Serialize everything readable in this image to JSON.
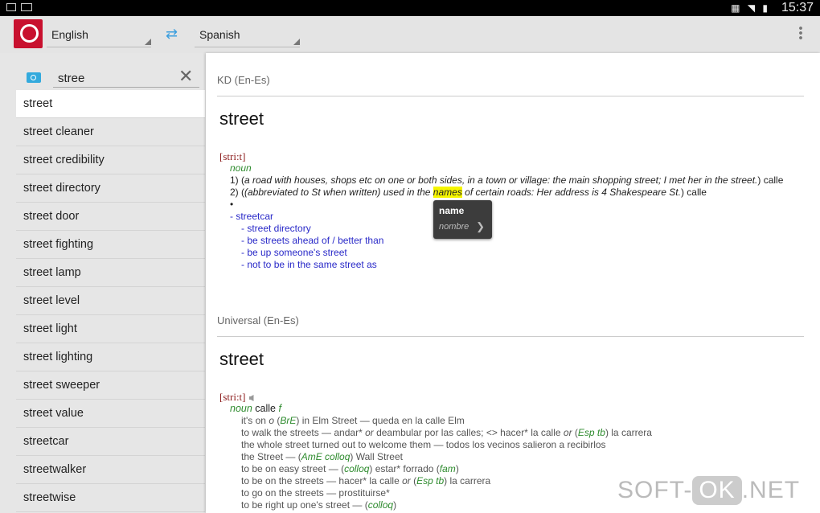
{
  "status": {
    "time": "15:37"
  },
  "toolbar": {
    "source_lang": "English",
    "target_lang": "Spanish"
  },
  "search": {
    "value": "stree"
  },
  "list": [
    "street",
    "street cleaner",
    "street credibility",
    "street directory",
    "street door",
    "street fighting",
    "street lamp",
    "street level",
    "street light",
    "street lighting",
    "street sweeper",
    "street value",
    "streetcar",
    "streetwalker",
    "streetwise"
  ],
  "kd": {
    "source": "KD (En-Es)",
    "headword": "street",
    "phon": "[stri:t]",
    "pos": "noun",
    "s1_num": "1) (",
    "s1_it": "a road with houses, shops etc on one or both sides, in a town or village: the main shopping street; I met her in the street.",
    "s1_end": ") calle",
    "s2_num": "2) (",
    "s2_it1": "(abbreviated to St when written) used in the ",
    "s2_hl": "names",
    "s2_it2": " of certain roads: Her address is 4 Shakespeare St.",
    "s2_end": ") calle",
    "bullet": "•",
    "links": [
      "- streetcar",
      "- street directory",
      "- be streets ahead of / better than",
      "- be up someone's street",
      "- not to be in the same street as"
    ]
  },
  "popup": {
    "word": "name",
    "translation": "nombre"
  },
  "uni": {
    "source": "Universal (En-Es)",
    "headword": "street",
    "phon": "[stri:t]",
    "pos": "noun",
    "trans": " calle ",
    "gender": "f",
    "examples": [
      [
        "it's on ",
        {
          "i": "o"
        },
        " (",
        {
          "g": "BrE"
        },
        ") in Elm Street — queda en la calle Elm"
      ],
      [
        "to walk the streets — andar* ",
        {
          "i": "or"
        },
        " deambular por las calles; <> hacer* la calle ",
        {
          "i": "or"
        },
        " (",
        {
          "g": "Esp tb"
        },
        ") la carrera"
      ],
      [
        "the whole street turned out to welcome them — todos los vecinos salieron a recibirlos"
      ],
      [
        "the Street — (",
        {
          "g": "AmE colloq"
        },
        ") Wall Street"
      ],
      [
        "to be on easy street — (",
        {
          "g": "colloq"
        },
        ") estar* forrado (",
        {
          "g": "fam"
        },
        ")"
      ],
      [
        "to be on the streets — hacer* la calle ",
        {
          "i": "or"
        },
        " (",
        {
          "g": "Esp tb"
        },
        ") la carrera"
      ],
      [
        "to go on the streets — prostituirse*"
      ],
      [
        "to be right up one's street — (",
        {
          "g": "colloq"
        },
        ")"
      ]
    ]
  },
  "watermark": {
    "a": "SOFT-",
    "b": "OK",
    ".c": ".NET",
    "c": ".NET"
  }
}
